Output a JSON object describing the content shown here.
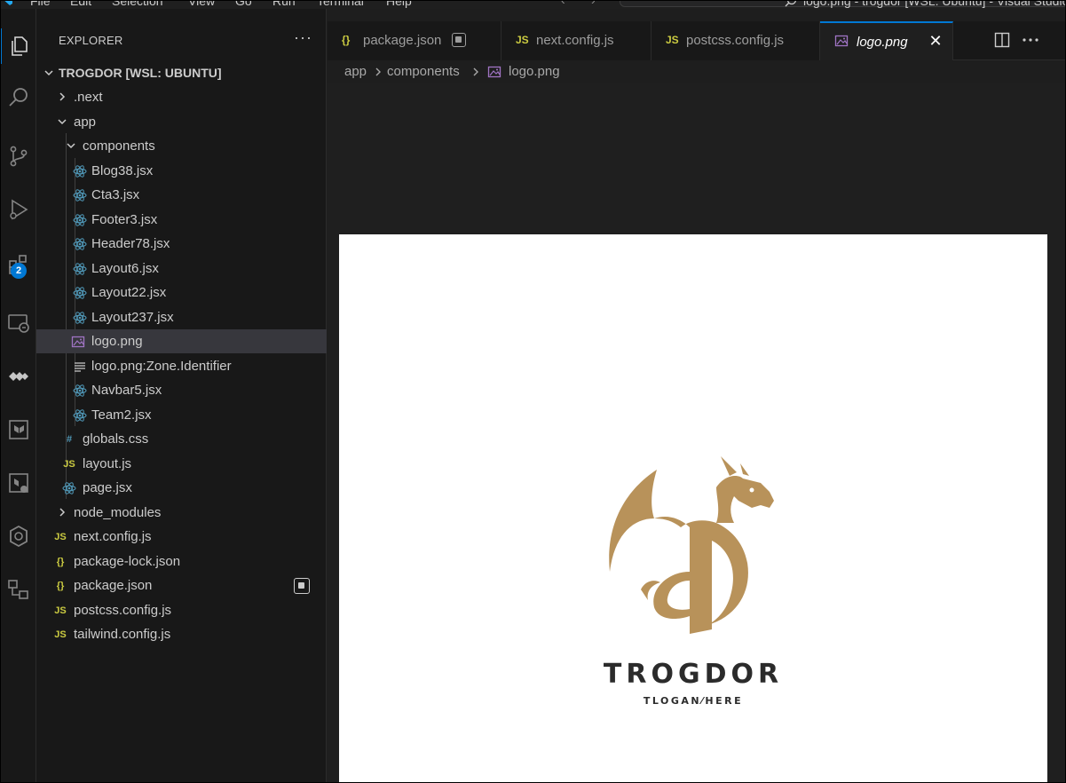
{
  "menubar": {
    "items": [
      "File",
      "Edit",
      "Selection",
      "View",
      "Go",
      "Run",
      "Terminal",
      "Help"
    ],
    "command_center": "logo.png - trogdor [WSL: Ubuntu] - Visual Studio Code"
  },
  "activity_bar": {
    "items": [
      "explorer-icon",
      "search-icon",
      "source-control-icon",
      "run-debug-icon",
      "extensions-icon",
      "remote-explorer-icon",
      "azure-icon",
      "terraform-icon",
      "terraform-cloud-icon",
      "kubernetes-icon",
      "remote-connections-icon"
    ],
    "extensions_badge": "2"
  },
  "sidebar": {
    "title": "EXPLORER",
    "more": "···",
    "root": "TROGDOR [WSL: UBUNTU]",
    "tree": [
      {
        "label": ".next"
      },
      {
        "label": "app"
      },
      {
        "label": "components"
      },
      {
        "label": "Blog38.jsx"
      },
      {
        "label": "Cta3.jsx"
      },
      {
        "label": "Footer3.jsx"
      },
      {
        "label": "Header78.jsx"
      },
      {
        "label": "Layout6.jsx"
      },
      {
        "label": "Layout22.jsx"
      },
      {
        "label": "Layout237.jsx"
      },
      {
        "label": "logo.png"
      },
      {
        "label": "logo.png:Zone.Identifier"
      },
      {
        "label": "Navbar5.jsx"
      },
      {
        "label": "Team2.jsx"
      },
      {
        "label": "globals.css"
      },
      {
        "label": "layout.js"
      },
      {
        "label": "page.jsx"
      },
      {
        "label": "node_modules"
      },
      {
        "label": "next.config.js"
      },
      {
        "label": "package-lock.json"
      },
      {
        "label": "package.json"
      },
      {
        "label": "postcss.config.js"
      },
      {
        "label": "tailwind.config.js"
      }
    ],
    "icon_text": {
      "js": "JS",
      "json": "{}",
      "css": "#"
    }
  },
  "tabs": [
    {
      "label": "package.json",
      "icon": "{}"
    },
    {
      "label": "next.config.js",
      "icon": "JS"
    },
    {
      "label": "postcss.config.js",
      "icon": "JS"
    },
    {
      "label": "logo.png",
      "icon": "image-icon",
      "close": "✕"
    }
  ],
  "breadcrumb": [
    "app",
    "components",
    "logo.png"
  ],
  "image": {
    "title": "TROGDOR",
    "slogan": "TLOGAN⁄HERE",
    "brand_color": "#b8925a"
  },
  "colors": {
    "accent": "#0078d4",
    "react": "#519aba",
    "js": "#cbcb41",
    "image": "#a074c4"
  }
}
